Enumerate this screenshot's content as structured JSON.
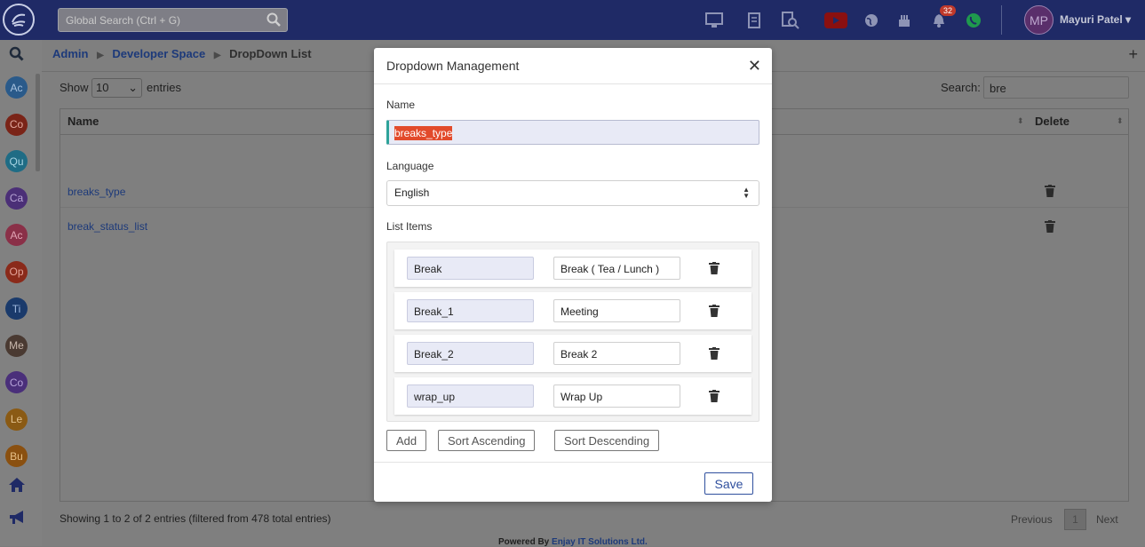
{
  "topbar": {
    "search_placeholder": "Global Search (Ctrl + G)",
    "notification_count": "32",
    "user_initials": "MP",
    "user_name": "Mayuri Patel"
  },
  "sidebar": {
    "items": [
      {
        "label": "Ac",
        "color": "#2a5a8a",
        "text_color": "#a9c3e0"
      },
      {
        "label": "Co",
        "color": "#7a2418",
        "text_color": "#e2a89e"
      },
      {
        "label": "Qu",
        "color": "#1f6c85",
        "text_color": "#a7d4e3"
      },
      {
        "label": "Ca",
        "color": "#4b2f77",
        "text_color": "#b8a5d6"
      },
      {
        "label": "Ac",
        "color": "#8a3048",
        "text_color": "#e2a5b5"
      },
      {
        "label": "Op",
        "color": "#8a2a1a",
        "text_color": "#e3a398"
      },
      {
        "label": "Ti",
        "color": "#1a3a6b",
        "text_color": "#9fb8de"
      },
      {
        "label": "Me",
        "color": "#4a3a32",
        "text_color": "#c9b8ad"
      },
      {
        "label": "Co",
        "color": "#4a2f7a",
        "text_color": "#b6a3d9"
      },
      {
        "label": "Le",
        "color": "#8a5a14",
        "text_color": "#e3c28e"
      },
      {
        "label": "Bu",
        "color": "#8a5010",
        "text_color": "#e6bf86"
      }
    ]
  },
  "breadcrumb": {
    "items": [
      "Admin",
      "Developer Space",
      "DropDown List"
    ]
  },
  "list_controls": {
    "show_label": "Show",
    "page_size": "10",
    "entries_label": "entries",
    "search_label": "Search:",
    "search_value": "bre"
  },
  "table": {
    "columns": [
      "Name",
      "Delete"
    ],
    "rows": [
      {
        "name": "breaks_type"
      },
      {
        "name": "break_status_list"
      }
    ]
  },
  "footer": {
    "info": "Showing 1 to 2 of 2 entries (filtered from 478 total entries)",
    "previous": "Previous",
    "page": "1",
    "next": "Next",
    "powered_prefix": "Powered By",
    "powered_company": "Enjay IT Solutions Ltd."
  },
  "modal": {
    "title": "Dropdown Management",
    "name_label": "Name",
    "name_value": "breaks_type",
    "language_label": "Language",
    "language_value": "English",
    "list_items_label": "List Items",
    "items": [
      {
        "key": "Break",
        "value": "Break ( Tea / Lunch )"
      },
      {
        "key": "Break_1",
        "value": "Meeting"
      },
      {
        "key": "Break_2",
        "value": "Break 2"
      },
      {
        "key": "wrap_up",
        "value": "Wrap Up"
      }
    ],
    "add_label": "Add",
    "sort_asc_label": "Sort Ascending",
    "sort_desc_label": "Sort Descending",
    "save_label": "Save"
  },
  "colors": {
    "topbar": "#1f2a66",
    "accent": "#2f4f9e",
    "selection": "#e24a2b"
  }
}
